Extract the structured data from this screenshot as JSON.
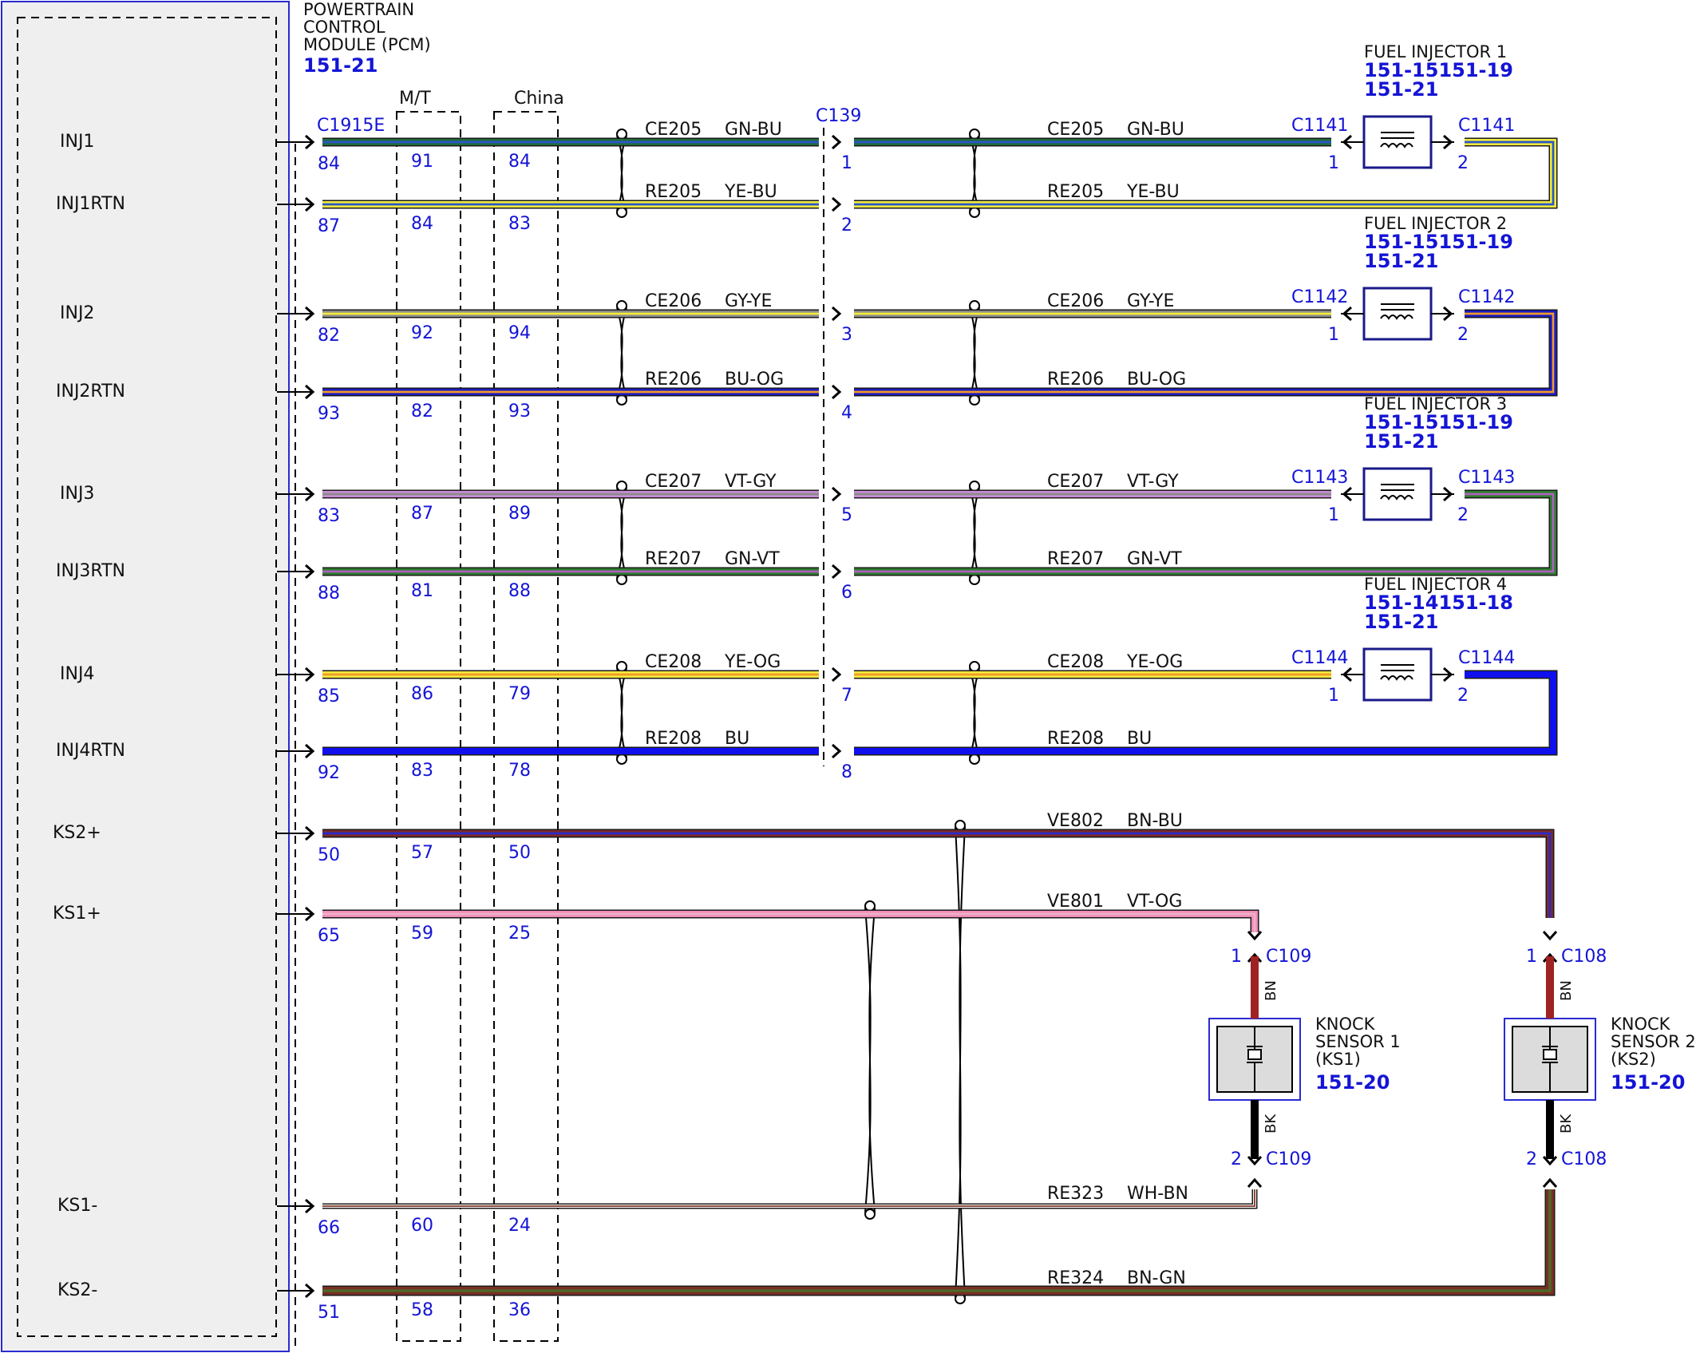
{
  "pcm": {
    "title_lines": [
      "POWERTRAIN",
      "CONTROL",
      "MODULE (PCM)"
    ],
    "ref": "151-21",
    "connector": "C1915E",
    "variant_mt": "M/T",
    "variant_china": "China"
  },
  "inline_connector": "C139",
  "signals": [
    {
      "name": "INJ1",
      "pin": "84",
      "pin_mt": "91",
      "pin_china": "84",
      "circuit": "CE205",
      "color_code": "GN-BU",
      "inline_pin": "1",
      "stripe": [
        "#1f6b3a",
        "#2a56c8"
      ]
    },
    {
      "name": "INJ1RTN",
      "pin": "87",
      "pin_mt": "84",
      "pin_china": "83",
      "circuit": "RE205",
      "color_code": "YE-BU",
      "inline_pin": "2",
      "stripe": [
        "#f2ea3c",
        "#2a56c8"
      ]
    },
    {
      "name": "INJ2",
      "pin": "82",
      "pin_mt": "92",
      "pin_china": "94",
      "circuit": "CE206",
      "color_code": "GY-YE",
      "inline_pin": "3",
      "stripe": [
        "#8c8c8c",
        "#f2ea3c"
      ]
    },
    {
      "name": "INJ2RTN",
      "pin": "93",
      "pin_mt": "82",
      "pin_china": "93",
      "circuit": "RE206",
      "color_code": "BU-OG",
      "inline_pin": "4",
      "stripe": [
        "#1b1bc4",
        "#f09a2a"
      ]
    },
    {
      "name": "INJ3",
      "pin": "83",
      "pin_mt": "87",
      "pin_china": "89",
      "circuit": "CE207",
      "color_code": "VT-GY",
      "inline_pin": "5",
      "stripe": [
        "#c98ad6",
        "#8c8c8c"
      ]
    },
    {
      "name": "INJ3RTN",
      "pin": "88",
      "pin_mt": "81",
      "pin_china": "88",
      "circuit": "RE207",
      "color_code": "GN-VT",
      "inline_pin": "6",
      "stripe": [
        "#2e7d2e",
        "#b060c0"
      ]
    },
    {
      "name": "INJ4",
      "pin": "85",
      "pin_mt": "86",
      "pin_china": "79",
      "circuit": "CE208",
      "color_code": "YE-OG",
      "inline_pin": "7",
      "stripe": [
        "#f2ea3c",
        "#f09a2a"
      ]
    },
    {
      "name": "INJ4RTN",
      "pin": "92",
      "pin_mt": "83",
      "pin_china": "78",
      "circuit": "RE208",
      "color_code": "BU",
      "inline_pin": "8",
      "stripe": [
        "#1010ee",
        "#1010ee"
      ]
    },
    {
      "name": "KS2+",
      "pin": "50",
      "pin_mt": "57",
      "pin_china": "50",
      "circuit": "VE802",
      "color_code": "BN-BU",
      "stripe": [
        "#7a2a2a",
        "#2a2ac8"
      ]
    },
    {
      "name": "KS1+",
      "pin": "65",
      "pin_mt": "59",
      "pin_china": "25",
      "circuit": "VE801",
      "color_code": "VT-OG",
      "stripe": [
        "#f08cb8",
        "#f0b0c8"
      ]
    },
    {
      "name": "KS1-",
      "pin": "66",
      "pin_mt": "60",
      "pin_china": "24",
      "circuit": "RE323",
      "color_code": "WH-BN",
      "stripe": [
        "#ffffff",
        "#8b4a3c"
      ]
    },
    {
      "name": "KS2-",
      "pin": "51",
      "pin_mt": "58",
      "pin_china": "36",
      "circuit": "RE324",
      "color_code": "BN-GN",
      "stripe": [
        "#7a2f22",
        "#4a6a2a"
      ]
    }
  ],
  "injectors": [
    {
      "title": "FUEL INJECTOR 1",
      "ref1": "151-15151-19",
      "ref2": "151-21",
      "connector": "C1141",
      "pin_in": "1",
      "pin_out": "2"
    },
    {
      "title": "FUEL INJECTOR 2",
      "ref1": "151-15151-19",
      "ref2": "151-21",
      "connector": "C1142",
      "pin_in": "1",
      "pin_out": "2"
    },
    {
      "title": "FUEL INJECTOR 3",
      "ref1": "151-15151-19",
      "ref2": "151-21",
      "connector": "C1143",
      "pin_in": "1",
      "pin_out": "2"
    },
    {
      "title": "FUEL INJECTOR 4",
      "ref1": "151-14151-18",
      "ref2": "151-21",
      "connector": "C1144",
      "pin_in": "1",
      "pin_out": "2"
    }
  ],
  "knock_sensors": [
    {
      "title_lines": [
        "KNOCK",
        "SENSOR 1",
        "(KS1)"
      ],
      "ref": "151-20",
      "connector": "C109",
      "pin_top": "1",
      "pin_bottom": "2",
      "top_wire": "BN",
      "bottom_wire": "BK"
    },
    {
      "title_lines": [
        "KNOCK",
        "SENSOR 2",
        "(KS2)"
      ],
      "ref": "151-20",
      "connector": "C108",
      "pin_top": "1",
      "pin_bottom": "2",
      "top_wire": "BN",
      "bottom_wire": "BK"
    }
  ]
}
